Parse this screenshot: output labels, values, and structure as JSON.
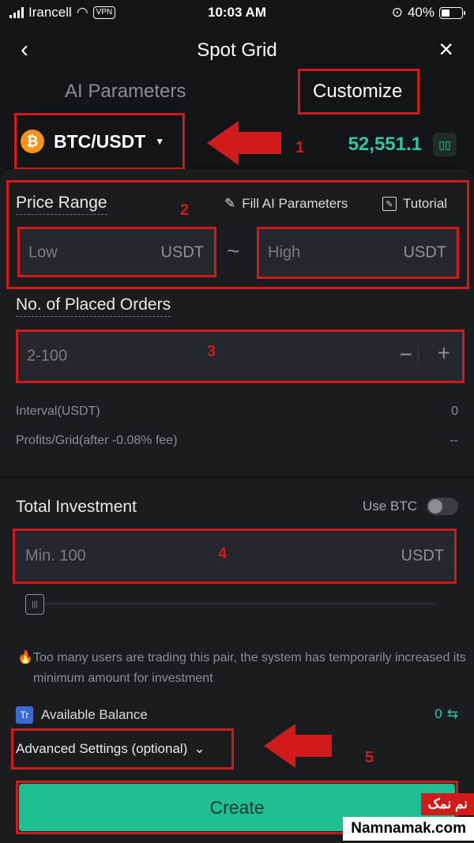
{
  "status_bar": {
    "carrier": "Irancell",
    "vpn": "VPN",
    "time": "10:03 AM",
    "battery": "40%"
  },
  "nav": {
    "title": "Spot Grid"
  },
  "tabs": [
    {
      "label": "AI Parameters"
    },
    {
      "label": "Customize"
    }
  ],
  "pair": {
    "name": "BTC/USDT",
    "coin_glyph": "₿",
    "price": "52,551.1"
  },
  "price_range": {
    "label": "Price Range",
    "fill_ai": "Fill AI Parameters",
    "tutorial": "Tutorial",
    "low": {
      "placeholder": "Low",
      "unit": "USDT"
    },
    "high": {
      "placeholder": "High",
      "unit": "USDT"
    },
    "separator": "~"
  },
  "orders": {
    "label": "No. of Placed Orders",
    "placeholder": "2-100",
    "minus": "−",
    "plus": "+"
  },
  "interval": {
    "label": "Interval(USDT)",
    "value": "0"
  },
  "profits": {
    "label": "Profits/Grid(after -0.08% fee)",
    "value": "--"
  },
  "investment": {
    "label": "Total Investment",
    "use_btc": "Use BTC",
    "use_btc_on": false,
    "placeholder": "Min. 100",
    "unit": "USDT"
  },
  "warning": "Too many users are trading this pair, the system has temporarily increased its minimum amount for investment",
  "balance": {
    "label": "Available Balance",
    "icon_text": "Tr",
    "value": "0"
  },
  "advanced": {
    "label": "Advanced Settings (optional)"
  },
  "create": {
    "label": "Create"
  },
  "annotations": [
    "1",
    "2",
    "3",
    "4",
    "5"
  ],
  "watermark": {
    "fa": "نم نمک",
    "en": "Namnamak.com"
  },
  "colors": {
    "accent": "#2fc99f",
    "button": "#1fbf92",
    "annotation": "#d11a1a",
    "background": "#121417"
  }
}
